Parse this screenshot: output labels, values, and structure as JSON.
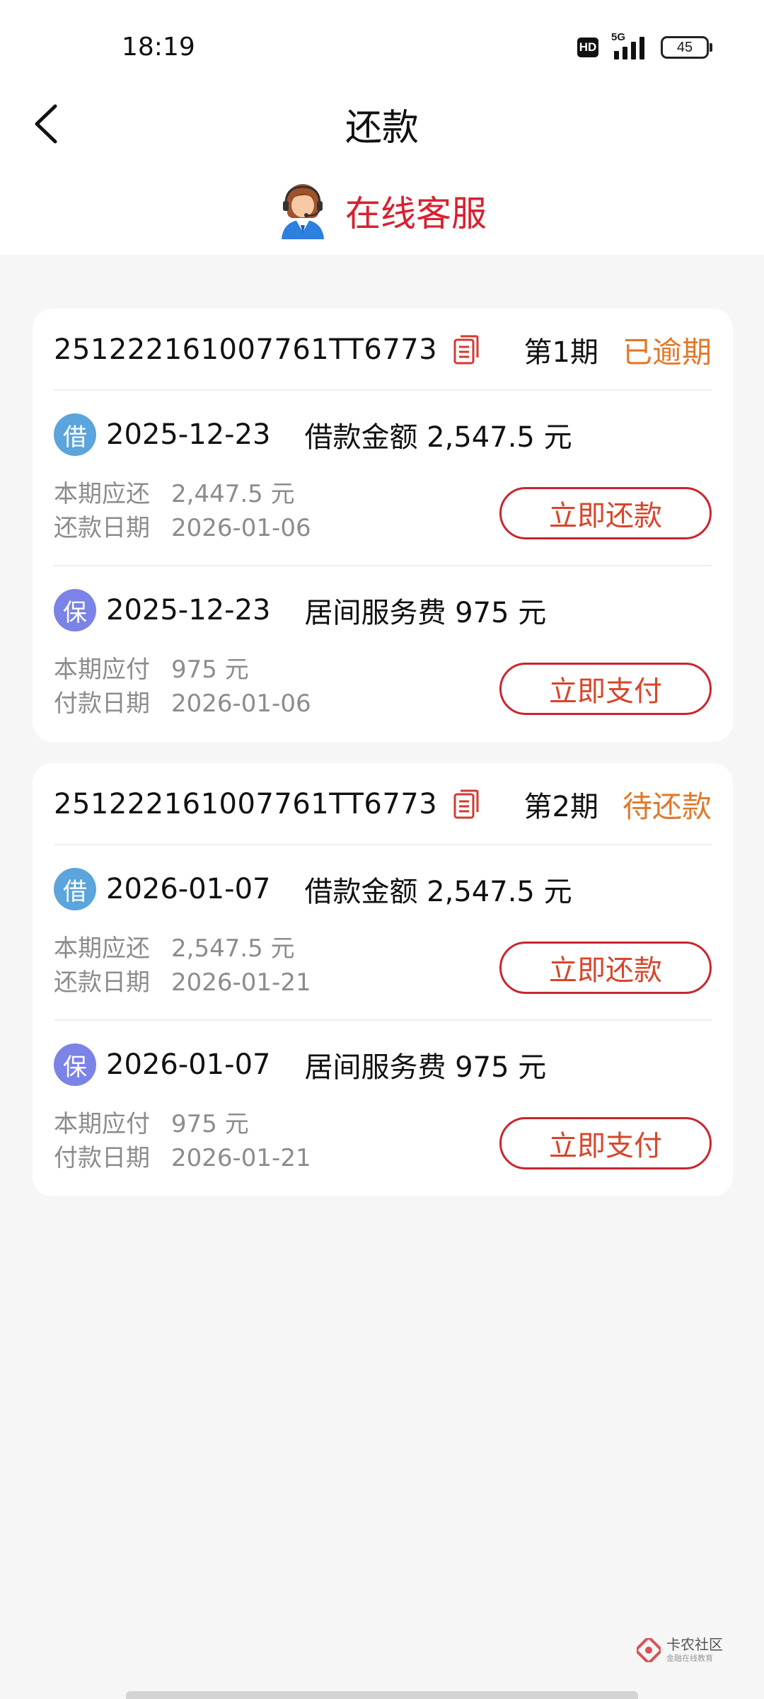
{
  "status_bar": {
    "time": "18:19",
    "hd": "HD",
    "network": "5G",
    "battery": "45"
  },
  "header": {
    "title": "还款",
    "service_label": "在线客服"
  },
  "colors": {
    "brand_red": "#d8202f",
    "status_orange": "#e0792a",
    "badge_loan": "#5ba4dc",
    "badge_guarantee": "#7b83e6"
  },
  "cards": [
    {
      "order_no": "251222161007761TT6773",
      "period": "第1期",
      "status": "已逾期",
      "loan": {
        "badge": "借",
        "date": "2025-12-23",
        "desc": "借款金额 2,547.5 元",
        "due_label": "本期应还",
        "due_value": "2,447.5 元",
        "date_label": "还款日期",
        "date_value": "2026-01-06",
        "button": "立即还款"
      },
      "fee": {
        "badge": "保",
        "date": "2025-12-23",
        "desc": "居间服务费 975 元",
        "due_label": "本期应付",
        "due_value": "975 元",
        "date_label": "付款日期",
        "date_value": "2026-01-06",
        "button": "立即支付"
      }
    },
    {
      "order_no": "251222161007761TT6773",
      "period": "第2期",
      "status": "待还款",
      "loan": {
        "badge": "借",
        "date": "2026-01-07",
        "desc": "借款金额 2,547.5 元",
        "due_label": "本期应还",
        "due_value": "2,547.5 元",
        "date_label": "还款日期",
        "date_value": "2026-01-21",
        "button": "立即还款"
      },
      "fee": {
        "badge": "保",
        "date": "2026-01-07",
        "desc": "居间服务费 975 元",
        "due_label": "本期应付",
        "due_value": "975 元",
        "date_label": "付款日期",
        "date_value": "2026-01-21",
        "button": "立即支付"
      }
    }
  ],
  "watermark": {
    "title": "卡农社区",
    "subtitle": "金融在线教育"
  }
}
